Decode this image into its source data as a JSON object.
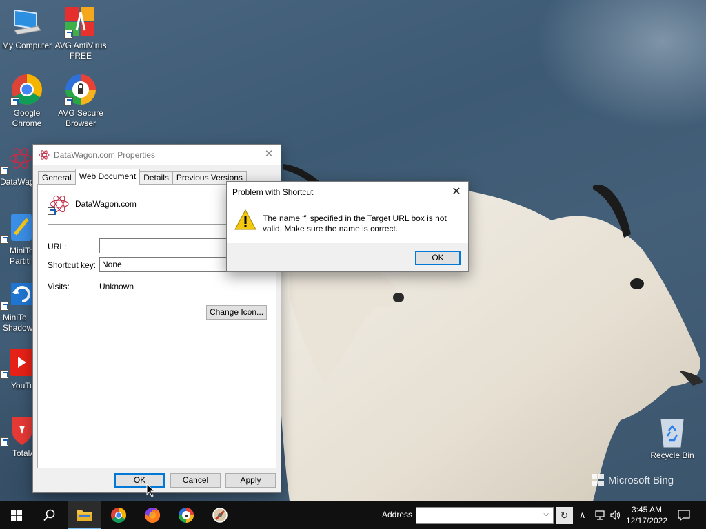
{
  "desktop": {
    "icons": [
      {
        "label": "My Computer"
      },
      {
        "label": "AVG AntiVirus FREE"
      },
      {
        "label": "Google Chrome"
      },
      {
        "label": "AVG Secure Browser"
      },
      {
        "label": "DataWag"
      },
      {
        "label": "MiniTo Partiti"
      },
      {
        "label": "MiniTo Shadow"
      },
      {
        "label": "YouTu"
      },
      {
        "label": "TotalA"
      },
      {
        "label": "Recycle Bin"
      }
    ],
    "watermark": "Microsoft Bing"
  },
  "properties_dialog": {
    "title": "DataWagon.com Properties",
    "tabs": [
      {
        "label": "General",
        "active": false
      },
      {
        "label": "Web Document",
        "active": true
      },
      {
        "label": "Details",
        "active": false
      },
      {
        "label": "Previous Versions",
        "active": false
      }
    ],
    "doc_name": "DataWagon.com",
    "url_label": "URL:",
    "url_value": "",
    "shortcut_label": "Shortcut key:",
    "shortcut_value": "None",
    "visits_label": "Visits:",
    "visits_value": "Unknown",
    "change_icon_label": "Change Icon...",
    "ok_label": "OK",
    "cancel_label": "Cancel",
    "apply_label": "Apply"
  },
  "error_dialog": {
    "title": "Problem with Shortcut",
    "message": "The name “” specified in the Target URL box is not valid. Make sure the name is correct.",
    "ok_label": "OK"
  },
  "taskbar": {
    "address_label": "Address",
    "address_value": "",
    "time": "3:45 AM",
    "date": "12/17/2022"
  },
  "colors": {
    "accent": "#0078d7",
    "taskbar": "#101010",
    "warning": "#f2c811"
  }
}
